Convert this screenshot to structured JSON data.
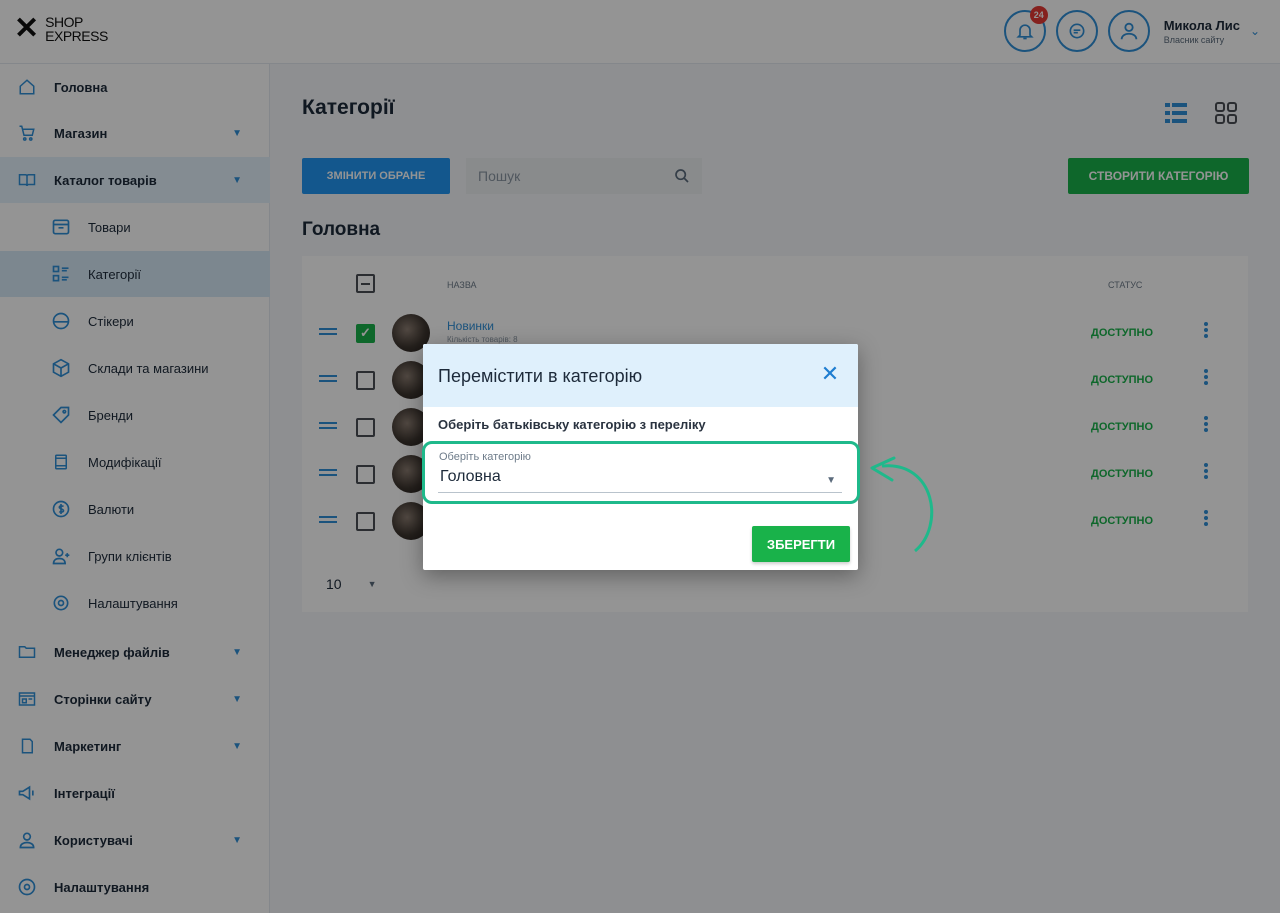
{
  "header": {
    "logo": {
      "line1": "SHOP",
      "line2": "EXPRESS"
    },
    "notifications_count": "24",
    "user_name": "Микола Лис",
    "user_role": "Власник сайту"
  },
  "sidebar": {
    "items": [
      {
        "label": "Головна",
        "icon": "home-icon"
      },
      {
        "label": "Магазин",
        "icon": "cart-icon",
        "has_submenu": true
      },
      {
        "label": "Каталог товарів",
        "icon": "book-icon",
        "has_submenu": true,
        "active": true
      },
      {
        "label": "Менеджер файлів",
        "icon": "folder-icon",
        "has_submenu": true
      },
      {
        "label": "Сторінки сайту",
        "icon": "pages-icon",
        "has_submenu": true
      },
      {
        "label": "Маркетинг",
        "icon": "marketing-icon",
        "has_submenu": true
      },
      {
        "label": "Інтеграції",
        "icon": "megaphone-icon"
      },
      {
        "label": "Користувачі",
        "icon": "users-icon",
        "has_submenu": true
      },
      {
        "label": "Налаштування",
        "icon": "gear-icon"
      }
    ],
    "catalog_sub": [
      {
        "label": "Товари",
        "icon": "box-icon"
      },
      {
        "label": "Категорії",
        "icon": "categories-icon",
        "active": true
      },
      {
        "label": "Стікери",
        "icon": "sticker-icon"
      },
      {
        "label": "Склади та магазини",
        "icon": "warehouse-icon"
      },
      {
        "label": "Бренди",
        "icon": "tag-icon"
      },
      {
        "label": "Модифікації",
        "icon": "modification-icon"
      },
      {
        "label": "Валюти",
        "icon": "currency-icon"
      },
      {
        "label": "Групи клієнтів",
        "icon": "client-group-icon"
      },
      {
        "label": "Налаштування",
        "icon": "gear-icon"
      }
    ]
  },
  "main": {
    "title": "Категорії",
    "change_selected_label": "Змінити обране",
    "search_placeholder": "Пошук",
    "create_label": "Створити категорію",
    "section_title": "Головна",
    "columns": {
      "name": "Назва",
      "status": "Статус"
    },
    "rows": [
      {
        "name": "Новинки",
        "sub": "Кількість товарів: 8",
        "status": "Доступно",
        "checked": true
      },
      {
        "name": "",
        "sub": "",
        "status": "Доступно",
        "checked": false
      },
      {
        "name": "",
        "sub": "",
        "status": "Доступно",
        "checked": false
      },
      {
        "name": "",
        "sub": "",
        "status": "Доступно",
        "checked": false
      },
      {
        "name": "",
        "sub": "",
        "status": "Доступно",
        "checked": false
      }
    ],
    "per_page": "10"
  },
  "modal": {
    "title": "Перемістити в категорію",
    "instruction": "Оберіть батьківську категорію з переліку",
    "select_caption": "Оберіть категорію",
    "select_value": "Головна",
    "save_label": "Зберегти"
  },
  "colors": {
    "primary_blue": "#2196f3",
    "accent_green": "#19b24a",
    "highlight": "#1fb98b",
    "modal_header": "#dff0fc"
  }
}
